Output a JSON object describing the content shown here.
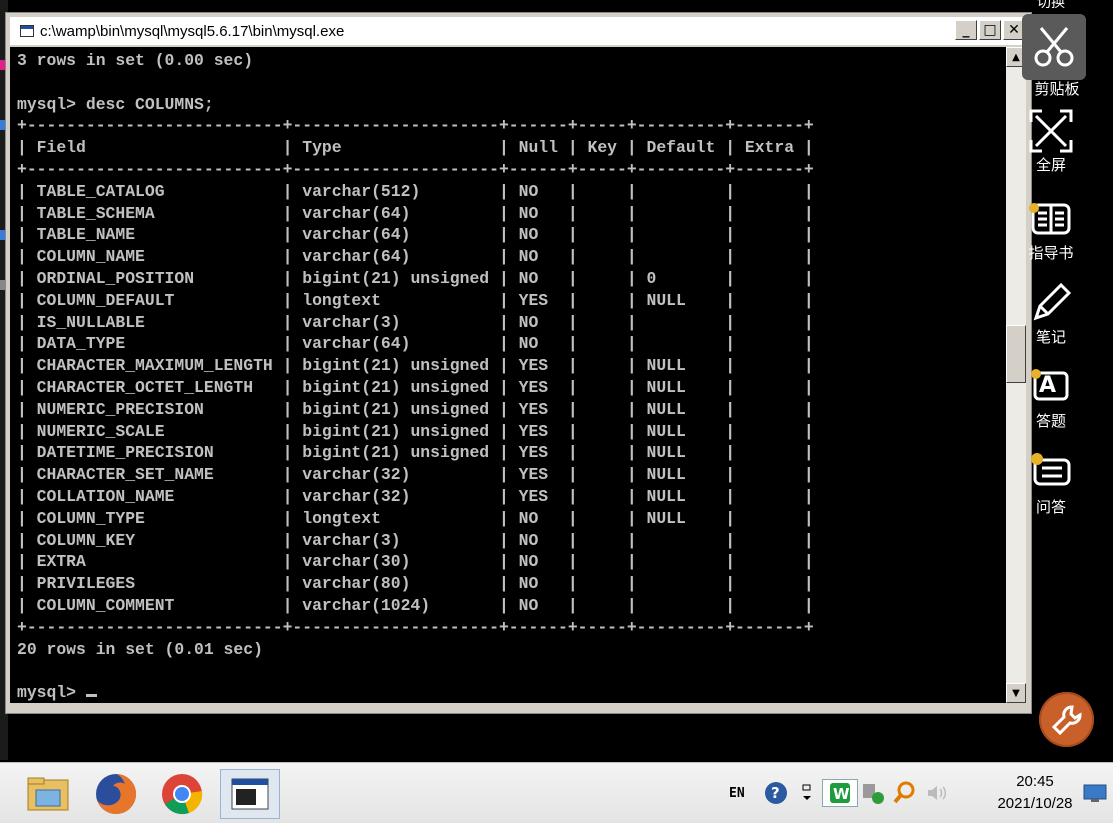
{
  "window": {
    "title": "c:\\wamp\\bin\\mysql\\mysql5.6.17\\bin\\mysql.exe",
    "minimize_label": "_",
    "maximize_label": "□",
    "close_label": "✕"
  },
  "console": {
    "prev_result": "3 rows in set (0.00 sec)",
    "command": "mysql> desc COLUMNS;",
    "border": "+--------------------------+---------------------+------+-----+---------+-------+",
    "header": "| Field                    | Type                | Null | Key | Default | Extra |",
    "rows": [
      "| TABLE_CATALOG            | varchar(512)        | NO   |     |         |       |",
      "| TABLE_SCHEMA             | varchar(64)         | NO   |     |         |       |",
      "| TABLE_NAME               | varchar(64)         | NO   |     |         |       |",
      "| COLUMN_NAME              | varchar(64)         | NO   |     |         |       |",
      "| ORDINAL_POSITION         | bigint(21) unsigned | NO   |     | 0       |       |",
      "| COLUMN_DEFAULT           | longtext            | YES  |     | NULL    |       |",
      "| IS_NULLABLE              | varchar(3)          | NO   |     |         |       |",
      "| DATA_TYPE                | varchar(64)         | NO   |     |         |       |",
      "| CHARACTER_MAXIMUM_LENGTH | bigint(21) unsigned | YES  |     | NULL    |       |",
      "| CHARACTER_OCTET_LENGTH   | bigint(21) unsigned | YES  |     | NULL    |       |",
      "| NUMERIC_PRECISION        | bigint(21) unsigned | YES  |     | NULL    |       |",
      "| NUMERIC_SCALE            | bigint(21) unsigned | YES  |     | NULL    |       |",
      "| DATETIME_PRECISION       | bigint(21) unsigned | YES  |     | NULL    |       |",
      "| CHARACTER_SET_NAME       | varchar(32)         | YES  |     | NULL    |       |",
      "| COLLATION_NAME           | varchar(32)         | YES  |     | NULL    |       |",
      "| COLUMN_TYPE              | longtext            | NO   |     | NULL    |       |",
      "| COLUMN_KEY               | varchar(3)          | NO   |     |         |       |",
      "| EXTRA                    | varchar(30)         | NO   |     |         |       |",
      "| PRIVILEGES               | varchar(80)         | NO   |     |         |       |",
      "| COLUMN_COMMENT           | varchar(1024)       | NO   |     |         |       |"
    ],
    "result": "20 rows in set (0.01 sec)",
    "prompt": "mysql> ",
    "scroll_up": "▲",
    "scroll_down": "▼"
  },
  "side_panel": {
    "top_text": "切换",
    "tools": [
      {
        "label": "剪贴板",
        "icon": "scissors-icon"
      },
      {
        "label": "全屏",
        "icon": "fullscreen-icon"
      },
      {
        "label": "指导书",
        "icon": "book-icon"
      },
      {
        "label": "笔记",
        "icon": "pencil-icon"
      },
      {
        "label": "答题",
        "icon": "answer-icon"
      },
      {
        "label": "问答",
        "icon": "qa-icon"
      }
    ],
    "settings_icon": "wrench-icon"
  },
  "taskbar": {
    "apps": [
      "file-explorer-icon",
      "firefox-icon",
      "chrome-icon",
      "console-window-icon"
    ],
    "language": "EN",
    "time": "20:45",
    "date": "2021/10/28"
  },
  "colors": {
    "console_bg": "#000000",
    "console_text": "#c0c0c0",
    "window_chrome": "#d4d0c8",
    "accent_orange": "#c9602a"
  }
}
